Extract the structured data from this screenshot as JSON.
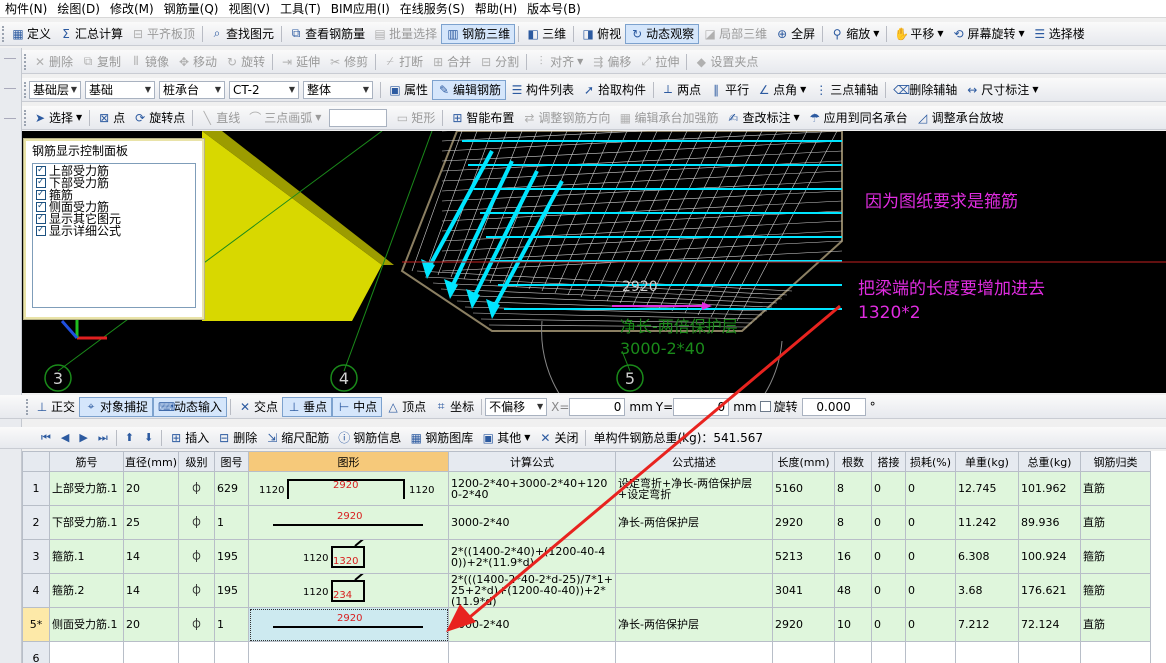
{
  "menubar": {
    "items": [
      "构件(N)",
      "绘图(D)",
      "修改(M)",
      "钢筋量(Q)",
      "视图(V)",
      "工具(T)",
      "BIM应用(I)",
      "在线服务(S)",
      "帮助(H)",
      "版本号(B)"
    ]
  },
  "toolbar1": {
    "items": [
      {
        "label": "定义",
        "icon": "grid-icon",
        "enabled": true
      },
      {
        "label": "汇总计算",
        "icon": "sigma-icon",
        "enabled": true
      },
      {
        "label": "平齐板顶",
        "icon": "level-icon",
        "enabled": false
      },
      {
        "label": "查找图元",
        "icon": "find-icon",
        "enabled": true
      },
      {
        "label": "查看钢筋量",
        "icon": "view-rebar-icon",
        "enabled": true
      },
      {
        "label": "批量选择",
        "icon": "batch-select-icon",
        "enabled": false
      },
      {
        "label": "钢筋三维",
        "icon": "rebar-3d-icon",
        "enabled": true,
        "active": true
      },
      {
        "label": "三维",
        "icon": "cube-icon",
        "enabled": true
      },
      {
        "label": "俯视",
        "icon": "topview-icon",
        "enabled": true
      },
      {
        "label": "动态观察",
        "icon": "orbit-icon",
        "enabled": true,
        "active": true
      },
      {
        "label": "局部三维",
        "icon": "local-3d-icon",
        "enabled": false
      },
      {
        "label": "全屏",
        "icon": "fullscreen-icon",
        "enabled": true
      },
      {
        "label": "缩放",
        "icon": "zoom-icon",
        "enabled": true
      },
      {
        "label": "平移",
        "icon": "pan-icon",
        "enabled": true
      },
      {
        "label": "屏幕旋转",
        "icon": "rotate-screen-icon",
        "enabled": true
      },
      {
        "label": "选择楼",
        "icon": "floor-select-icon",
        "enabled": true
      }
    ]
  },
  "toolbar2": {
    "items": [
      {
        "label": "删除",
        "icon": "delete-icon"
      },
      {
        "label": "复制",
        "icon": "copy-icon"
      },
      {
        "label": "镜像",
        "icon": "mirror-icon"
      },
      {
        "label": "移动",
        "icon": "move-icon"
      },
      {
        "label": "旋转",
        "icon": "rotate-icon"
      },
      {
        "label": "延伸",
        "icon": "extend-icon"
      },
      {
        "label": "修剪",
        "icon": "trim-icon"
      },
      {
        "label": "打断",
        "icon": "break-icon"
      },
      {
        "label": "合并",
        "icon": "merge-icon"
      },
      {
        "label": "分割",
        "icon": "split-icon"
      },
      {
        "label": "对齐",
        "icon": "align-icon"
      },
      {
        "label": "偏移",
        "icon": "offset-icon"
      },
      {
        "label": "拉伸",
        "icon": "stretch-icon"
      },
      {
        "label": "设置夹点",
        "icon": "grip-icon"
      }
    ]
  },
  "toolbar3": {
    "combos": [
      "基础层",
      "基础",
      "桩承台",
      "CT-2",
      "整体"
    ],
    "items": [
      {
        "label": "属性",
        "icon": "properties-icon",
        "enabled": true
      },
      {
        "label": "编辑钢筋",
        "icon": "edit-rebar-icon",
        "enabled": true,
        "active": true
      },
      {
        "label": "构件列表",
        "icon": "component-list-icon",
        "enabled": true
      },
      {
        "label": "拾取构件",
        "icon": "pick-icon",
        "enabled": true
      },
      {
        "label": "两点",
        "icon": "two-point-icon",
        "enabled": true
      },
      {
        "label": "平行",
        "icon": "parallel-icon",
        "enabled": true
      },
      {
        "label": "点角",
        "icon": "point-angle-icon",
        "enabled": true
      },
      {
        "label": "三点辅轴",
        "icon": "three-point-axis-icon",
        "enabled": true
      },
      {
        "label": "删除辅轴",
        "icon": "delete-axis-icon",
        "enabled": true
      },
      {
        "label": "尺寸标注",
        "icon": "dimension-icon",
        "enabled": true
      }
    ]
  },
  "toolbar4": {
    "items": [
      {
        "label": "选择",
        "icon": "cursor-icon",
        "enabled": true
      },
      {
        "label": "点",
        "icon": "point-icon",
        "enabled": true
      },
      {
        "label": "旋转点",
        "icon": "rotate-point-icon",
        "enabled": true
      },
      {
        "label": "直线",
        "icon": "line-icon",
        "enabled": false
      },
      {
        "label": "三点画弧",
        "icon": "arc-icon",
        "enabled": false
      },
      {
        "label": "矩形",
        "icon": "rectangle-icon",
        "enabled": false
      },
      {
        "label": "智能布置",
        "icon": "smart-layout-icon",
        "enabled": true
      },
      {
        "label": "调整钢筋方向",
        "icon": "adjust-direction-icon",
        "enabled": false
      },
      {
        "label": "编辑承台加强筋",
        "icon": "edit-reinforce-icon",
        "enabled": false
      },
      {
        "label": "查改标注",
        "icon": "edit-label-icon",
        "enabled": true
      },
      {
        "label": "应用到同名承台",
        "icon": "apply-same-icon",
        "enabled": true
      },
      {
        "label": "调整承台放坡",
        "icon": "slope-icon",
        "enabled": true
      }
    ]
  },
  "panel": {
    "title": "钢筋显示控制面板",
    "items": [
      "上部受力筋",
      "下部受力筋",
      "箍筋",
      "侧面受力筋",
      "显示其它图元",
      "显示详细公式"
    ]
  },
  "viewport": {
    "dim_value": "2920",
    "dim_desc": "净长-两倍保护层",
    "dim_formula": "3000-2*40",
    "axis_labels": [
      "3",
      "4",
      "5"
    ],
    "annotation1": "因为图纸要求是箍筋",
    "annotation2_line1": "把梁端的长度要增加进去",
    "annotation2_line2": "1320*2",
    "annotation_color": "#e02ce0",
    "arrow_color": "#e8231f"
  },
  "snapbar": {
    "items": [
      {
        "label": "正交",
        "icon": "ortho-icon",
        "active": false
      },
      {
        "label": "对象捕捉",
        "icon": "snap-icon",
        "active": true
      },
      {
        "label": "动态输入",
        "icon": "dynamic-input-icon",
        "active": true
      },
      {
        "label": "交点",
        "icon": "intersection-icon",
        "active": false
      },
      {
        "label": "垂点",
        "icon": "perpendicular-icon",
        "active": true
      },
      {
        "label": "中点",
        "icon": "midpoint-icon",
        "active": true
      },
      {
        "label": "顶点",
        "icon": "vertex-icon",
        "active": false
      },
      {
        "label": "坐标",
        "icon": "coordinate-icon",
        "active": false
      }
    ],
    "offset_mode": "不偏移",
    "x_label": "X=",
    "x_value": "0",
    "y_label": "Y=",
    "y_value": "0",
    "unit": "mm",
    "rotate_label": "旋转",
    "rotate_value": "0.000",
    "degree": "°"
  },
  "listbar": {
    "items": [
      {
        "label": "插入",
        "icon": "insert-icon"
      },
      {
        "label": "删除",
        "icon": "delete-row-icon"
      },
      {
        "label": "缩尺配筋",
        "icon": "scale-rebar-icon"
      },
      {
        "label": "钢筋信息",
        "icon": "rebar-info-icon"
      },
      {
        "label": "钢筋图库",
        "icon": "rebar-library-icon"
      },
      {
        "label": "其他",
        "icon": "other-icon"
      },
      {
        "label": "关闭",
        "icon": "close-icon"
      }
    ],
    "total_weight": "单构件钢筋总重(kg)：541.567"
  },
  "table": {
    "headers": [
      "",
      "筋号",
      "直径(mm)",
      "级别",
      "图号",
      "图形",
      "计算公式",
      "公式描述",
      "长度(mm)",
      "根数",
      "搭接",
      "损耗(%)",
      "单重(kg)",
      "总重(kg)",
      "钢筋归类"
    ],
    "rows": [
      {
        "no": "1",
        "name": "上部受力筋.1",
        "dia": "20",
        "grade": "⏀",
        "fig": "629",
        "shape": {
          "type": "u",
          "left": "1120",
          "mid": "2920",
          "right": "1120"
        },
        "formula": "1200-2*40+3000-2*40+1200-2*40",
        "desc": "设定弯折+净长-两倍保护层+设定弯折",
        "len": "5160",
        "count": "8",
        "lap": "0",
        "loss": "0",
        "unit_w": "12.745",
        "total_w": "101.962",
        "cat": "直筋"
      },
      {
        "no": "2",
        "name": "下部受力筋.1",
        "dia": "25",
        "grade": "⏀",
        "fig": "1",
        "shape": {
          "type": "line",
          "mid": "2920"
        },
        "formula": "3000-2*40",
        "desc": "净长-两倍保护层",
        "len": "2920",
        "count": "8",
        "lap": "0",
        "loss": "0",
        "unit_w": "11.242",
        "total_w": "89.936",
        "cat": "直筋"
      },
      {
        "no": "3",
        "name": "箍筋.1",
        "dia": "14",
        "grade": "⏀",
        "fig": "195",
        "shape": {
          "type": "stirrup",
          "left": "1120",
          "mid": "1320"
        },
        "formula": "2*((1400-2*40)+(1200-40-40))+2*(11.9*d)",
        "desc": "",
        "len": "5213",
        "count": "16",
        "lap": "0",
        "loss": "0",
        "unit_w": "6.308",
        "total_w": "100.924",
        "cat": "箍筋"
      },
      {
        "no": "4",
        "name": "箍筋.2",
        "dia": "14",
        "grade": "⏀",
        "fig": "195",
        "shape": {
          "type": "stirrup",
          "left": "1120",
          "mid": "234"
        },
        "formula": "2*(((1400-2*40-2*d-25)/7*1+25+2*d)+(1200-40-40))+2*(11.9*d)",
        "desc": "",
        "len": "3041",
        "count": "48",
        "lap": "0",
        "loss": "0",
        "unit_w": "3.68",
        "total_w": "176.621",
        "cat": "箍筋"
      },
      {
        "no": "5*",
        "name": "侧面受力筋.1",
        "dia": "20",
        "grade": "⏀",
        "fig": "1",
        "shape": {
          "type": "line",
          "mid": "2920"
        },
        "formula": "3000-2*40",
        "desc": "净长-两倍保护层",
        "len": "2920",
        "count": "10",
        "lap": "0",
        "loss": "0",
        "unit_w": "7.212",
        "total_w": "72.124",
        "cat": "直筋"
      },
      {
        "no": "6",
        "name": "",
        "dia": "",
        "grade": "",
        "fig": "",
        "shape": {
          "type": "none"
        },
        "formula": "",
        "desc": "",
        "len": "",
        "count": "",
        "lap": "",
        "loss": "",
        "unit_w": "",
        "total_w": "",
        "cat": ""
      }
    ]
  }
}
